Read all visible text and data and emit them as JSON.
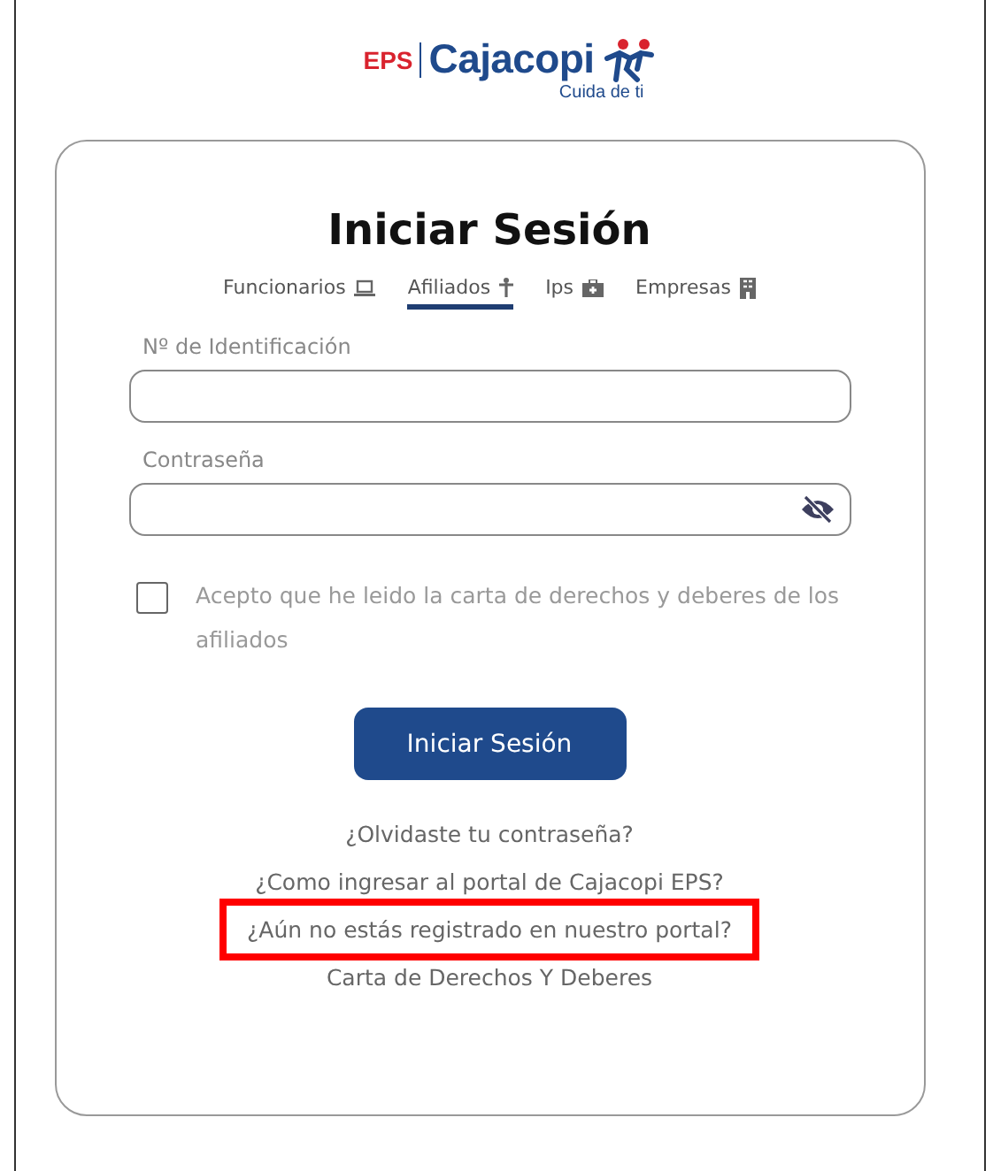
{
  "logo": {
    "prefix": "EPS",
    "name": "Cajacopi",
    "tagline": "Cuida de ti"
  },
  "title": "Iniciar Sesión",
  "tabs": [
    {
      "label": "Funcionarios",
      "kind": "laptop",
      "selected": false
    },
    {
      "label": "Afiliados",
      "kind": "person",
      "selected": true
    },
    {
      "label": "Ips",
      "kind": "medkit",
      "selected": false
    },
    {
      "label": "Empresas",
      "kind": "building",
      "selected": false
    }
  ],
  "fields": [
    {
      "label": "Nº de Identificación",
      "kind": "text"
    },
    {
      "label": "Contraseña",
      "kind": "password"
    }
  ],
  "consent": {
    "text": "Acepto que he leido la carta de derechos y deberes de los afiliados",
    "checked": false
  },
  "submit": "Iniciar Sesión",
  "links": [
    {
      "text": "¿Olvidaste tu contraseña?",
      "highlighted": false
    },
    {
      "text": "¿Como ingresar al portal de Cajacopi EPS?",
      "highlighted": false
    },
    {
      "text": "¿Aún no estás registrado en nuestro portal?",
      "highlighted": true
    },
    {
      "text": "Carta de Derechos Y Deberes",
      "highlighted": false
    }
  ]
}
